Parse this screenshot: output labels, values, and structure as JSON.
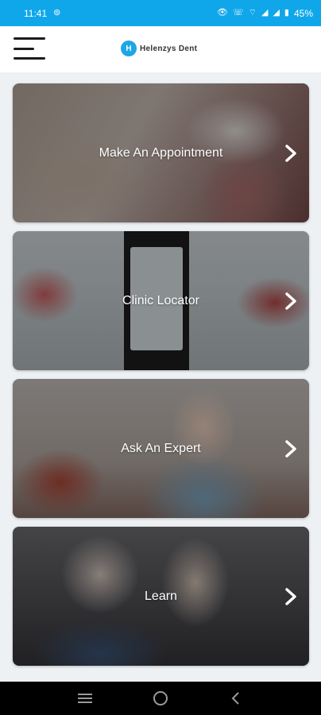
{
  "status_bar": {
    "time": "11:41",
    "battery": "45%",
    "background_color": "#10a7ea"
  },
  "header": {
    "menu_icon": "hamburger-menu-icon",
    "logo_mark": "H",
    "logo_text": "Helenzys Dent"
  },
  "cards": [
    {
      "label": "Make An Appointment",
      "icon": "chevron-right-icon"
    },
    {
      "label": "Clinic Locator",
      "icon": "chevron-right-icon"
    },
    {
      "label": "Ask An Expert",
      "icon": "chevron-right-icon"
    },
    {
      "label": "Learn",
      "icon": "chevron-right-icon"
    }
  ],
  "nav_bar": {
    "items": [
      "recent-apps-icon",
      "home-icon",
      "back-icon"
    ]
  }
}
